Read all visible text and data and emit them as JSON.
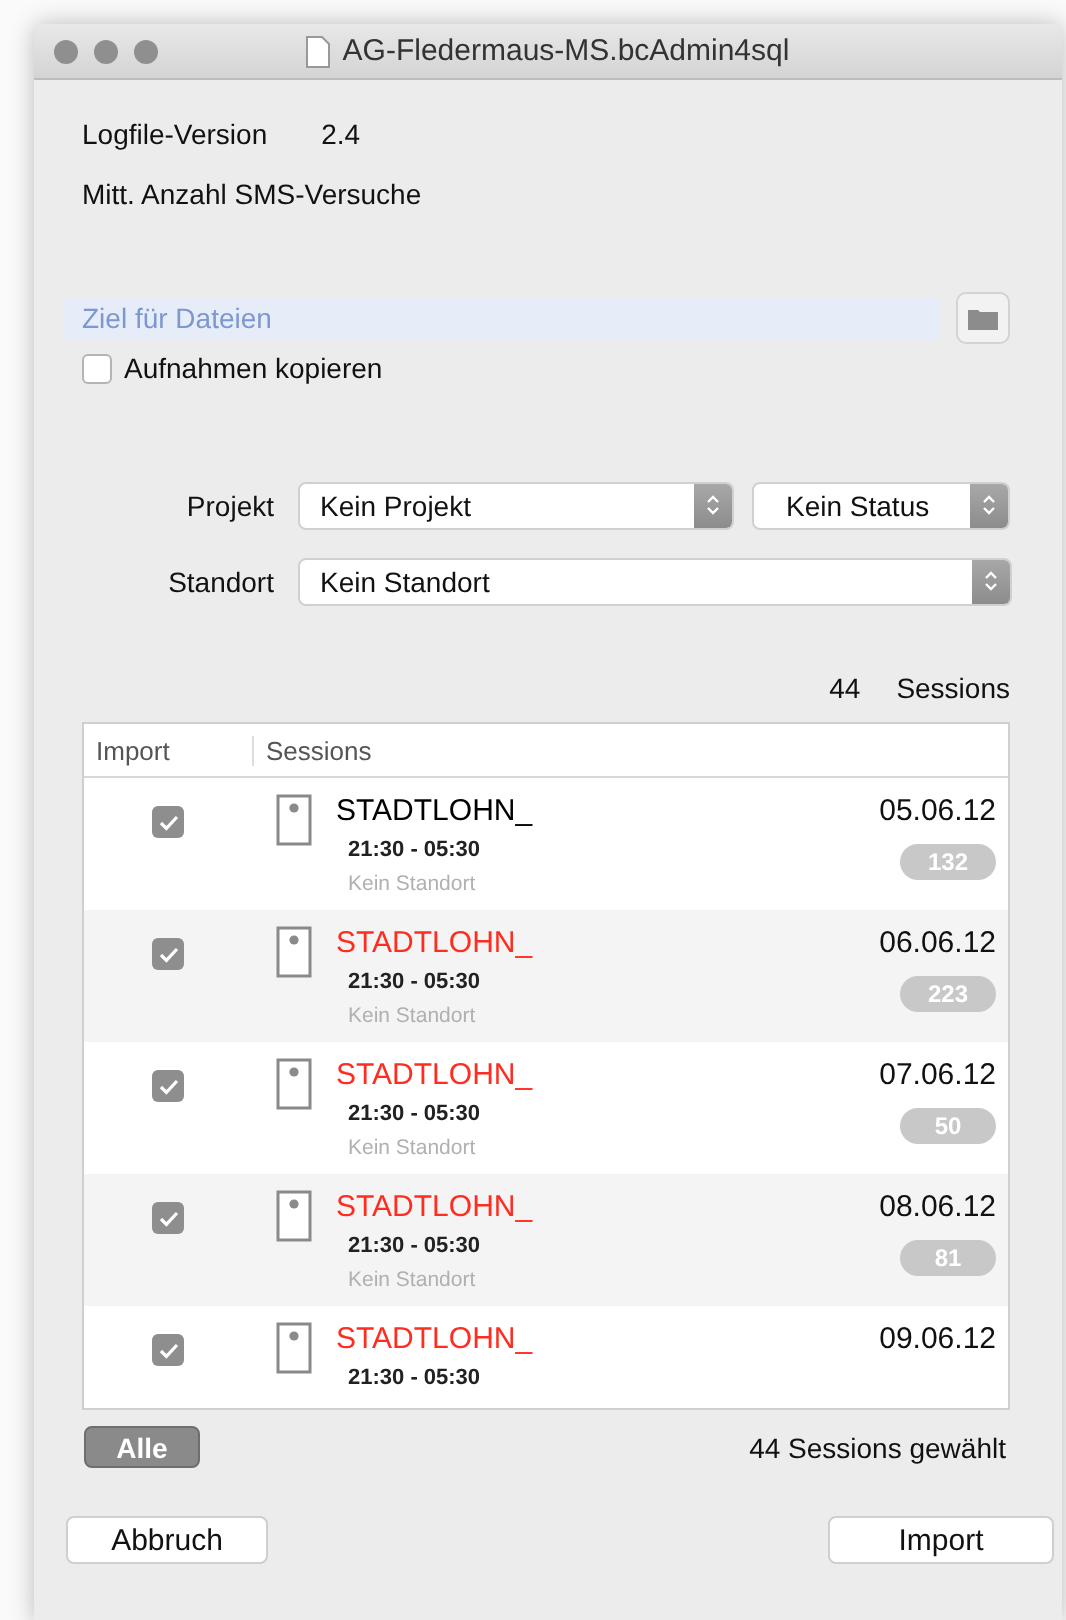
{
  "window": {
    "title": "AG-Fledermaus-MS.bcAdmin4sql"
  },
  "info": [
    {
      "label": "Logfile-Version",
      "value": "2.4"
    },
    {
      "label": "Mitt. Anzahl SMS-Versuche"
    }
  ],
  "target_field": {
    "placeholder": "Ziel für Dateien"
  },
  "copy_checkbox": {
    "label": "Aufnahmen kopieren",
    "checked": false
  },
  "projekt": {
    "label": "Projekt",
    "value": "Kein Projekt",
    "status": "Kein Status"
  },
  "standort": {
    "label": "Standort",
    "value": "Kein Standort"
  },
  "session_count": {
    "count": "44",
    "label": "Sessions"
  },
  "table": {
    "columns": [
      "Import",
      "Sessions"
    ],
    "rows": [
      {
        "checked": true,
        "name": "STADTLOHN_",
        "color": "#000000",
        "time": "21:30 - 05:30",
        "location": "Kein Standort",
        "date": "05.06.12",
        "count": "132"
      },
      {
        "checked": true,
        "name": "STADTLOHN_",
        "color": "#ff2d20",
        "time": "21:30 - 05:30",
        "location": "Kein Standort",
        "date": "06.06.12",
        "count": "223"
      },
      {
        "checked": true,
        "name": "STADTLOHN_",
        "color": "#ff2d20",
        "time": "21:30 - 05:30",
        "location": "Kein Standort",
        "date": "07.06.12",
        "count": "50"
      },
      {
        "checked": true,
        "name": "STADTLOHN_",
        "color": "#ff2d20",
        "time": "21:30 - 05:30",
        "location": "Kein Standort",
        "date": "08.06.12",
        "count": "81"
      },
      {
        "checked": true,
        "name": "STADTLOHN_",
        "color": "#ff2d20",
        "time": "21:30 - 05:30",
        "date": "09.06.12"
      }
    ]
  },
  "all_button": "Alle",
  "selected_summary": "44 Sessions gewählt",
  "buttons": [
    "Abbruch",
    "Import"
  ]
}
